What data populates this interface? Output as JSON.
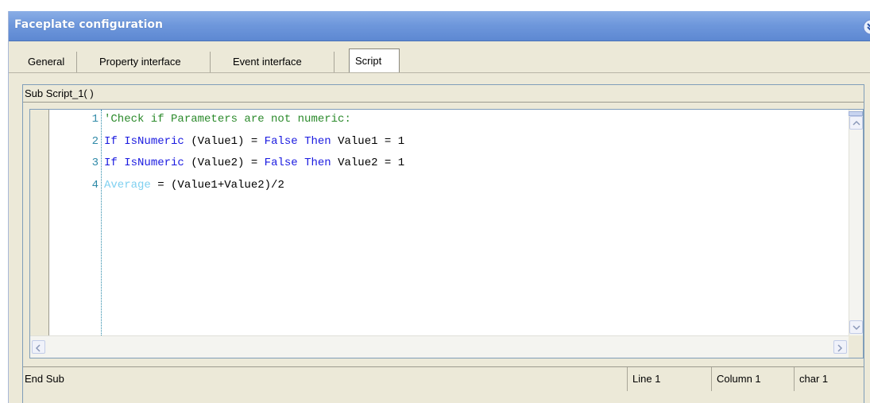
{
  "window": {
    "title": "Faceplate configuration"
  },
  "tabs": [
    {
      "label": "General"
    },
    {
      "label": "Property interface"
    },
    {
      "label": "Event interface"
    },
    {
      "label": "Script"
    }
  ],
  "script": {
    "header": "Sub Script_1( )",
    "footer": "End Sub",
    "lines": [
      {
        "num": "1",
        "tokens": [
          {
            "t": "'Check if Parameters are not numeric:",
            "k": "comment"
          }
        ]
      },
      {
        "num": "2",
        "tokens": [
          {
            "t": "If ",
            "k": "kw"
          },
          {
            "t": "IsNumeric",
            "k": "kw"
          },
          {
            "t": " (Value1) = ",
            "k": "plain"
          },
          {
            "t": "False",
            "k": "kw"
          },
          {
            "t": " ",
            "k": "plain"
          },
          {
            "t": "Then",
            "k": "kw"
          },
          {
            "t": " Value1 = 1",
            "k": "plain"
          }
        ]
      },
      {
        "num": "3",
        "tokens": [
          {
            "t": "If ",
            "k": "kw"
          },
          {
            "t": "IsNumeric",
            "k": "kw"
          },
          {
            "t": " (Value2) = ",
            "k": "plain"
          },
          {
            "t": "False",
            "k": "kw"
          },
          {
            "t": " ",
            "k": "plain"
          },
          {
            "t": "Then",
            "k": "kw"
          },
          {
            "t": " Value2 = 1",
            "k": "plain"
          }
        ]
      },
      {
        "num": "4",
        "tokens": [
          {
            "t": "Average",
            "k": "var"
          },
          {
            "t": " = (Value1+Value2)/2",
            "k": "plain"
          }
        ]
      }
    ]
  },
  "status": {
    "line": "Line 1",
    "column": "Column 1",
    "char": "char 1"
  },
  "colors": {
    "comment": "#2b8a2b",
    "keyword": "#1a1ae0",
    "variable": "#7fd0f0",
    "line_number": "#2f8aa8",
    "title_bar": "#6f98dc"
  },
  "icons": {
    "collapse": "double-chevron-icon",
    "scroll_up": "arrow-up-icon",
    "scroll_down": "arrow-down-icon",
    "scroll_left": "arrow-left-icon",
    "scroll_right": "arrow-right-icon"
  }
}
